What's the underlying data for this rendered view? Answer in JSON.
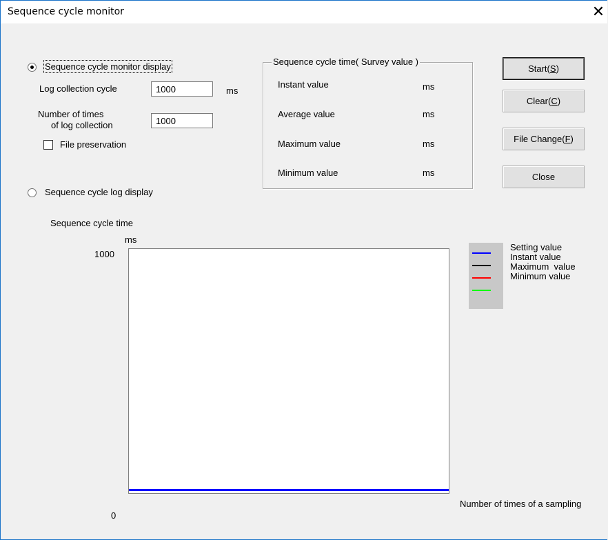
{
  "window": {
    "title": "Sequence cycle monitor",
    "close_glyph": "✕"
  },
  "monitor": {
    "radio_label": "Sequence cycle monitor display",
    "selected": true,
    "log_cycle_label": "Log collection cycle",
    "log_cycle_value": "1000",
    "log_cycle_unit": "ms",
    "num_times_label_1": "Number of times",
    "num_times_label_2": "of log collection",
    "num_times_value": "1000",
    "file_preservation_label": "File preservation",
    "file_preservation_checked": false
  },
  "log": {
    "radio_label": "Sequence cycle log display",
    "selected": false
  },
  "survey": {
    "title": "Sequence cycle time( Survey value )",
    "rows": [
      {
        "label": "Instant value",
        "unit": "ms"
      },
      {
        "label": "Average value",
        "unit": "ms"
      },
      {
        "label": "Maximum value",
        "unit": "ms"
      },
      {
        "label": "Minimum value",
        "unit": "ms"
      }
    ]
  },
  "buttons": {
    "start": {
      "label": "Start(",
      "key": "S",
      "end": ")"
    },
    "clear": {
      "label": "Clear(",
      "key": "C",
      "end": ")"
    },
    "file_change": {
      "label": "File Change(",
      "key": "F",
      "end": ")"
    },
    "close": {
      "label": "Close"
    }
  },
  "graph": {
    "title": "Sequence cycle time",
    "y_unit": "ms",
    "y_max_label": "1000",
    "y_min_label": "0",
    "x_label": "Number of times of a sampling",
    "legend": [
      {
        "label": "Setting value",
        "color": "#0000ff"
      },
      {
        "label": "Instant value",
        "color": "#000000"
      },
      {
        "label": "Maximum  value",
        "color": "#ff0000"
      },
      {
        "label": "Minimum value",
        "color": "#00ff00"
      }
    ],
    "setting_line_color": "#0000ff"
  }
}
